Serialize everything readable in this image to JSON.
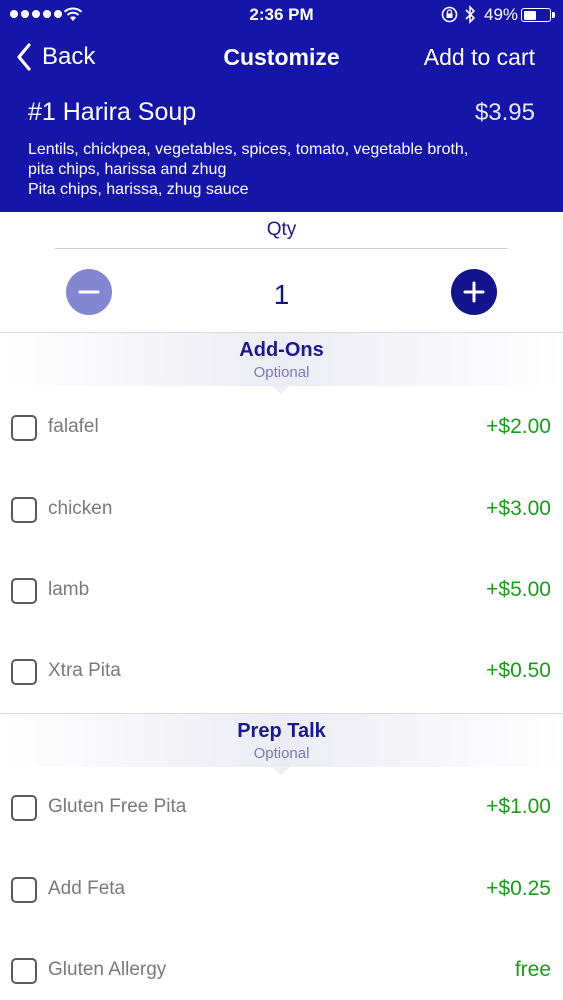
{
  "status_bar": {
    "time": "2:36 PM",
    "battery_percent": "49%",
    "battery_level": 0.49,
    "icons": [
      "signal-dots",
      "wifi-icon",
      "rotation-lock-icon",
      "bluetooth-icon",
      "battery-icon"
    ]
  },
  "nav": {
    "back_label": "Back",
    "title": "Customize",
    "add_to_cart_label": "Add to cart"
  },
  "item": {
    "name": "#1 Harira Soup",
    "price": "$3.95",
    "description_line1": "Lentils, chickpea, vegetables, spices, tomato, vegetable broth,",
    "description_line2": "pita chips, harissa and zhug",
    "description_line3": "Pita chips, harissa, zhug sauce"
  },
  "qty": {
    "label": "Qty",
    "value": "1"
  },
  "sections": [
    {
      "title": "Add-Ons",
      "subtitle": "Optional",
      "options": [
        {
          "label": "falafel",
          "price": "+$2.00",
          "checked": false
        },
        {
          "label": "chicken",
          "price": "+$3.00",
          "checked": false
        },
        {
          "label": "lamb",
          "price": "+$5.00",
          "checked": false
        },
        {
          "label": "Xtra Pita",
          "price": "+$0.50",
          "checked": false
        }
      ]
    },
    {
      "title": "Prep Talk",
      "subtitle": "Optional",
      "options": [
        {
          "label": "Gluten Free Pita",
          "price": "+$1.00",
          "checked": false
        },
        {
          "label": "Add Feta",
          "price": "+$0.25",
          "checked": false
        },
        {
          "label": "Gluten Allergy",
          "price": "free",
          "checked": false
        }
      ]
    }
  ],
  "colors": {
    "brand": "#1515a8",
    "price_green": "#1d9b1d",
    "minus_button": "#8386d0",
    "plus_button": "#13138e"
  }
}
